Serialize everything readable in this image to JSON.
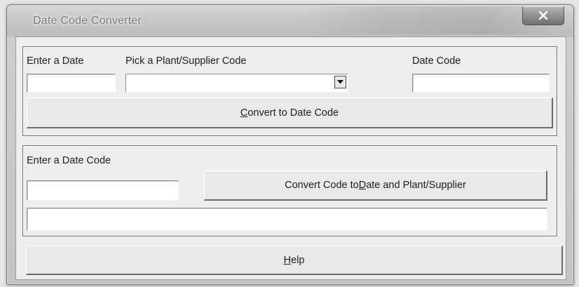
{
  "window": {
    "title": "Date Code Converter",
    "close_label": "X"
  },
  "encode_group": {
    "date_label": "Enter a Date",
    "date_value": "",
    "plant_label": "Pick a Plant/Supplier Code",
    "plant_selected": "",
    "date_code_label": "Date Code",
    "date_code_value": "",
    "convert_button": {
      "mnemonic": "C",
      "rest": "onvert to Date Code"
    }
  },
  "decode_group": {
    "date_code_label": "Enter a Date Code",
    "date_code_value": "",
    "convert_button": {
      "prefix": "Convert Code to ",
      "mnemonic": "D",
      "rest": "ate and Plant/Supplier"
    },
    "result_value": ""
  },
  "help_button": {
    "mnemonic": "H",
    "rest": "elp"
  },
  "icons": {
    "close": "close-icon",
    "dropdown": "chevron-down-icon"
  },
  "colors": {
    "window_frame": "#c4c4c4",
    "client_bg": "#ededed",
    "close_button": "#8e8e8e"
  }
}
